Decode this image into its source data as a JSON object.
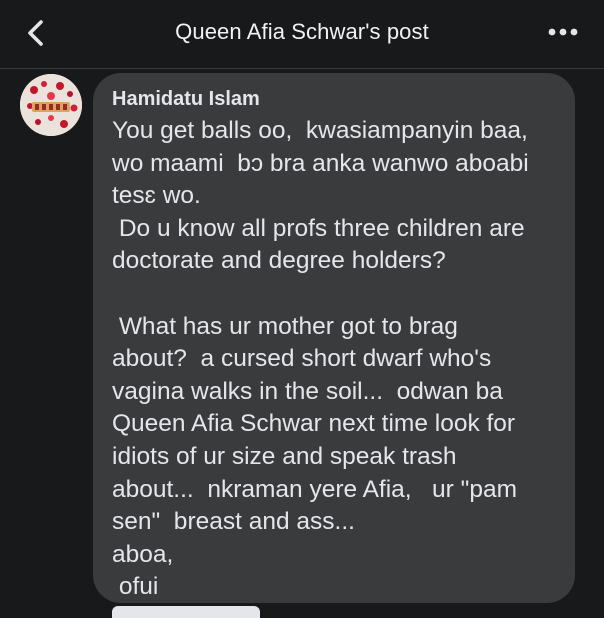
{
  "header": {
    "title": "Queen Afia Schwar's post",
    "back_icon": "chevron-left-icon",
    "more_icon": "more-horizontal-icon"
  },
  "comment": {
    "author": "Hamidatu Islam",
    "text": "You get balls oo,  kwasiampanyin baa,\nwo maami  bɔ bra anka wanwo aboabi\ntesɛ wo.\n Do u know all profs three children are\ndoctorate and degree holders?\n\n What has ur mother got to brag\nabout?  a cursed short dwarf who's\nvagina walks in the soil...  odwan ba\nQueen Afia Schwar next time look for\nidiots of ur size and speak trash\nabout...  nkraman yere Afia,   ur \"pam\nsen\"  breast and ass...\naboa,\n ofui"
  },
  "colors": {
    "background": "#18191a",
    "bubble": "#3a3b3c",
    "text": "#e4e6eb"
  }
}
